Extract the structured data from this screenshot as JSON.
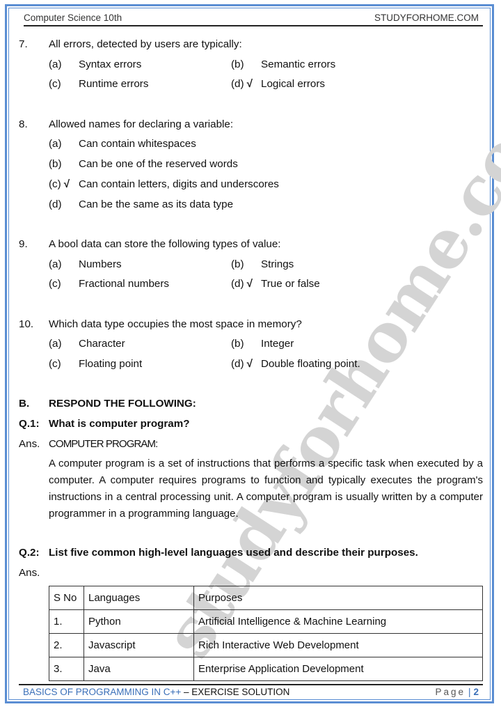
{
  "header": {
    "left": "Computer Science 10th",
    "right": "STUDYFORHOME.COM"
  },
  "watermark": "studyforhome.com",
  "questions": [
    {
      "number": "7.",
      "text": "All errors, detected by users are typically:",
      "layout": "two-column",
      "options": [
        {
          "label": "(a)",
          "text": "Syntax errors",
          "correct": false
        },
        {
          "label": "(b)",
          "text": "Semantic errors",
          "correct": false
        },
        {
          "label": "(c)",
          "text": "Runtime errors",
          "correct": false
        },
        {
          "label": "(d)",
          "text": "Logical errors",
          "correct": true
        }
      ]
    },
    {
      "number": "8.",
      "text": "Allowed names for declaring a variable:",
      "layout": "single-column",
      "options": [
        {
          "label": "(a)",
          "text": "Can contain whitespaces",
          "correct": false
        },
        {
          "label": "(b)",
          "text": "Can be one of the reserved words",
          "correct": false
        },
        {
          "label": "(c)",
          "text": "Can contain letters, digits and underscores",
          "correct": true
        },
        {
          "label": "(d)",
          "text": "Can be the same as its data type",
          "correct": false
        }
      ]
    },
    {
      "number": "9.",
      "text": "A bool data can store the following types of value:",
      "layout": "two-column",
      "options": [
        {
          "label": "(a)",
          "text": "Numbers",
          "correct": false
        },
        {
          "label": "(b)",
          "text": "Strings",
          "correct": false
        },
        {
          "label": "(c)",
          "text": "Fractional numbers",
          "correct": false
        },
        {
          "label": "(d)",
          "text": "True or false",
          "correct": true
        }
      ]
    },
    {
      "number": "10.",
      "text": "Which data type occupies the most space in memory?",
      "layout": "two-column",
      "options": [
        {
          "label": "(a)",
          "text": "Character",
          "correct": false
        },
        {
          "label": "(b)",
          "text": "Integer",
          "correct": false
        },
        {
          "label": "(c)",
          "text": "Floating point",
          "correct": false
        },
        {
          "label": "(d)",
          "text": "Double floating point.",
          "correct": true
        }
      ]
    }
  ],
  "tick_symbol": "√",
  "section_b": {
    "label": "B.",
    "title": "RESPOND THE FOLLOWING:"
  },
  "q1": {
    "label": "Q.1:",
    "question": "What is computer program?",
    "ans_label": "Ans.",
    "ans_title": "COMPUTER PROGRAM:",
    "paragraph": "A computer program is a set of instructions that performs a specific task when executed by a computer. A computer requires programs to function and typically executes the program's instructions in a central processing unit. A computer program is usually written by a computer programmer in a programming language."
  },
  "q2": {
    "label": "Q.2:",
    "question": "List five common high-level languages used and describe their purposes.",
    "ans_label": "Ans."
  },
  "table": {
    "headers": [
      "S No",
      "Languages",
      "Purposes"
    ],
    "rows": [
      [
        "1.",
        "Python",
        "Artificial Intelligence & Machine Learning"
      ],
      [
        "2.",
        "Javascript",
        "Rich Interactive Web Development"
      ],
      [
        "3.",
        "Java",
        "Enterprise Application Development"
      ]
    ]
  },
  "footer": {
    "title_blue": "BASICS OF PROGRAMMING IN C++",
    "title_rest": " – EXERCISE SOLUTION",
    "page_label": "Page",
    "page_separator": "|",
    "page_number": "2"
  },
  "colors": {
    "border": "#5b8ed3",
    "footer_accent": "#3a6fb8",
    "watermark": "#d4d4d4"
  }
}
